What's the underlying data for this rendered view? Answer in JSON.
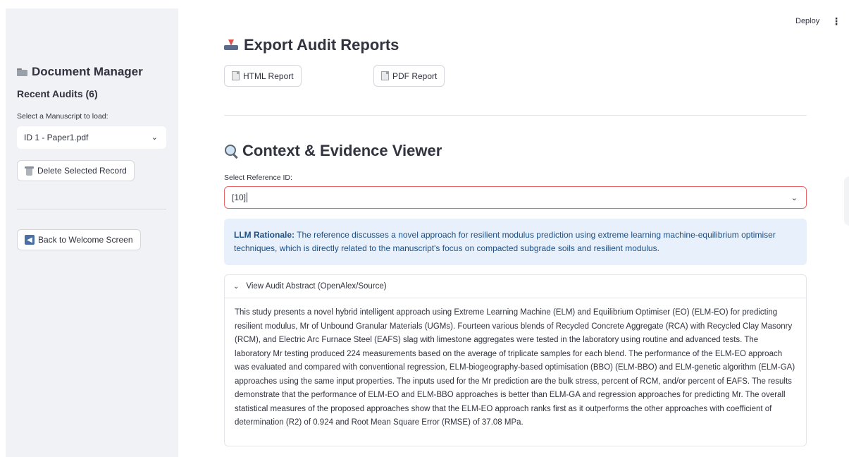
{
  "header": {
    "deploy_label": "Deploy",
    "menu_label": "⋮"
  },
  "sidebar": {
    "title": "Document Manager",
    "recent_audits": "Recent Audits (6)",
    "select_label": "Select a Manuscript to load:",
    "selected_manuscript": "ID 1 - Paper1.pdf",
    "delete_button": "Delete Selected Record",
    "back_button": "Back to Welcome Screen"
  },
  "export": {
    "title": "Export Audit Reports",
    "html_button": "HTML Report",
    "pdf_button": "PDF Report"
  },
  "viewer": {
    "title": "Context & Evidence Viewer",
    "select_label": "Select Reference ID:",
    "selected_ref": "[10]",
    "rationale_label": "LLM Rationale:",
    "rationale_text": " The reference discusses a novel approach for resilient modulus prediction using extreme learning machine-equilibrium optimiser techniques, which is directly related to the manuscript's focus on compacted subgrade soils and resilient modulus.",
    "expander_label": "View Audit Abstract (OpenAlex/Source)",
    "abstract": "This study presents a novel hybrid intelligent approach using Extreme Learning Machine (ELM) and Equilibrium Optimiser (EO) (ELM-EO) for predicting resilient modulus, Mr of Unbound Granular Materials (UGMs). Fourteen various blends of Recycled Concrete Aggregate (RCA) with Recycled Clay Masonry (RCM), and Electric Arc Furnace Steel (EAFS) slag with limestone aggregates were tested in the laboratory using routine and advanced tests. The laboratory Mr testing produced 224 measurements based on the average of triplicate samples for each blend. The performance of the ELM-EO approach was evaluated and compared with conventional regression, ELM-biogeography-based optimisation (BBO) (ELM-BBO) and ELM-genetic algorithm (ELM-GA) approaches using the same input properties. The inputs used for the Mr prediction are the bulk stress, percent of RCM, and/or percent of EAFS. The results demonstrate that the performance of ELM-EO and ELM-BBO approaches is better than ELM-GA and regression approaches for predicting Mr. The overall statistical measures of the proposed approaches show that the ELM-EO approach ranks first as it outperforms the other approaches with coefficient of determination (R2) of 0.924 and Root Mean Square Error (RMSE) of 37.08 MPa."
  }
}
